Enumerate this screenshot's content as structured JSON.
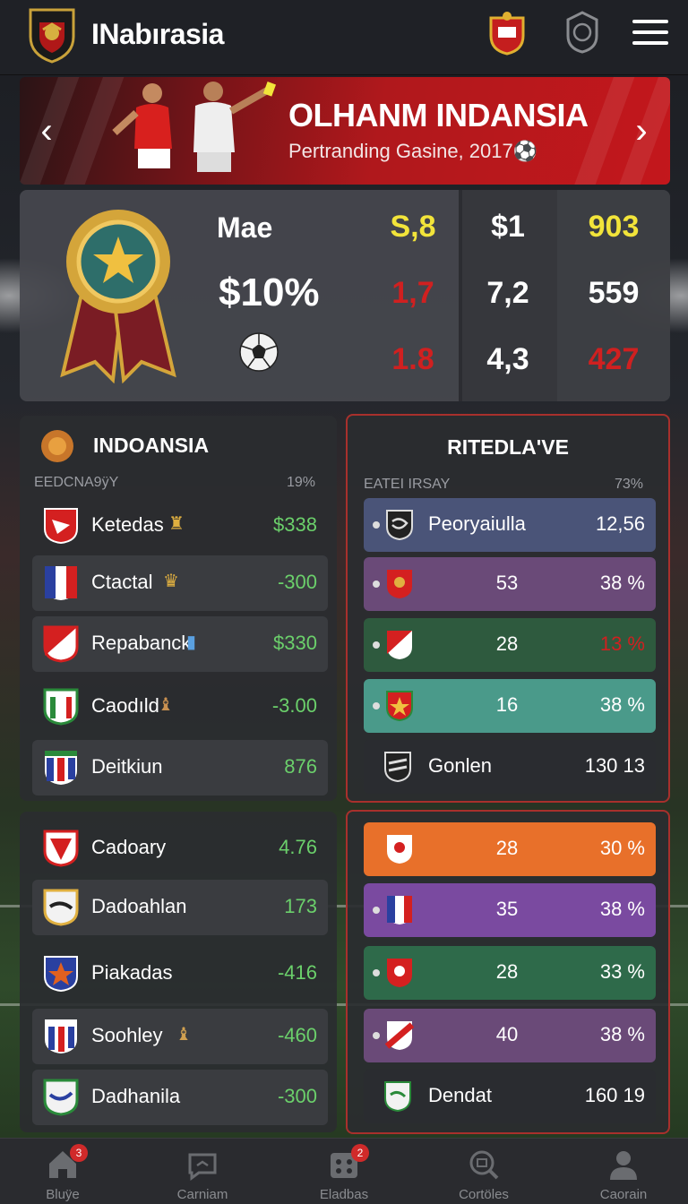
{
  "header": {
    "app_name": "INabırasia"
  },
  "banner": {
    "title": "OLHANM INDANSIA",
    "subtitle": "Pertranding Gasine, 2017⚽"
  },
  "stats": {
    "label": "Mae",
    "big_value": "$10%",
    "col1": [
      "S,8",
      "1,7",
      "1.8"
    ],
    "col2": [
      "$1",
      "7,2",
      "4,3"
    ],
    "col3": [
      "903",
      "559",
      "427"
    ]
  },
  "left_panel": {
    "title": "INDOANSIA",
    "subtitle": "EEDCNA9ÿY",
    "subtitle_value": "19%",
    "rows": [
      {
        "name": "Ketedas",
        "value": "$338"
      },
      {
        "name": "Ctactal",
        "value": "-300"
      },
      {
        "name": "Repabanck",
        "value": "$330"
      },
      {
        "name": "Caodıld",
        "value": "-3.00"
      },
      {
        "name": "Deitkiun",
        "value": "876"
      }
    ]
  },
  "right_panel": {
    "title": "RITEDLA'VE",
    "subtitle": "EATEI IRSAY",
    "subtitle_value": "73%",
    "rows": [
      {
        "name": "Peoryaiulla",
        "value": "12,56"
      },
      {
        "mid": "53",
        "value": "38 %"
      },
      {
        "mid": "28",
        "value": "13 %"
      },
      {
        "mid": "16",
        "value": "38 %"
      },
      {
        "name": "Gonlen",
        "value": "130 13"
      }
    ]
  },
  "left_panel2": {
    "rows": [
      {
        "name": "Cadoary",
        "value": "4.76"
      },
      {
        "name": "Dadoahlan",
        "value": "173"
      },
      {
        "name": "Piakadas",
        "value": "-416"
      },
      {
        "name": "Soohley",
        "value": "-460"
      },
      {
        "name": "Dadhanila",
        "value": "-300"
      }
    ]
  },
  "right_panel2": {
    "rows": [
      {
        "mid": "28",
        "value": "30 %"
      },
      {
        "mid": "35",
        "value": "38 %"
      },
      {
        "mid": "28",
        "value": "33 %"
      },
      {
        "mid": "40",
        "value": "38 %"
      },
      {
        "name": "Dendat",
        "value": "160 19"
      }
    ]
  },
  "tabbar": {
    "tabs": [
      {
        "label": "Bluÿe",
        "icon": "home-icon",
        "badge": "3"
      },
      {
        "label": "Carniam",
        "icon": "chat-icon"
      },
      {
        "label": "Eladbas",
        "icon": "grid-icon",
        "badge": "2"
      },
      {
        "label": "Cortöles",
        "icon": "search-icon"
      },
      {
        "label": "Caorain",
        "icon": "profile-icon"
      }
    ]
  },
  "colors": {
    "accent_red": "#c3171c",
    "positive": "#6bd06b",
    "yellow": "#f2e43a"
  }
}
